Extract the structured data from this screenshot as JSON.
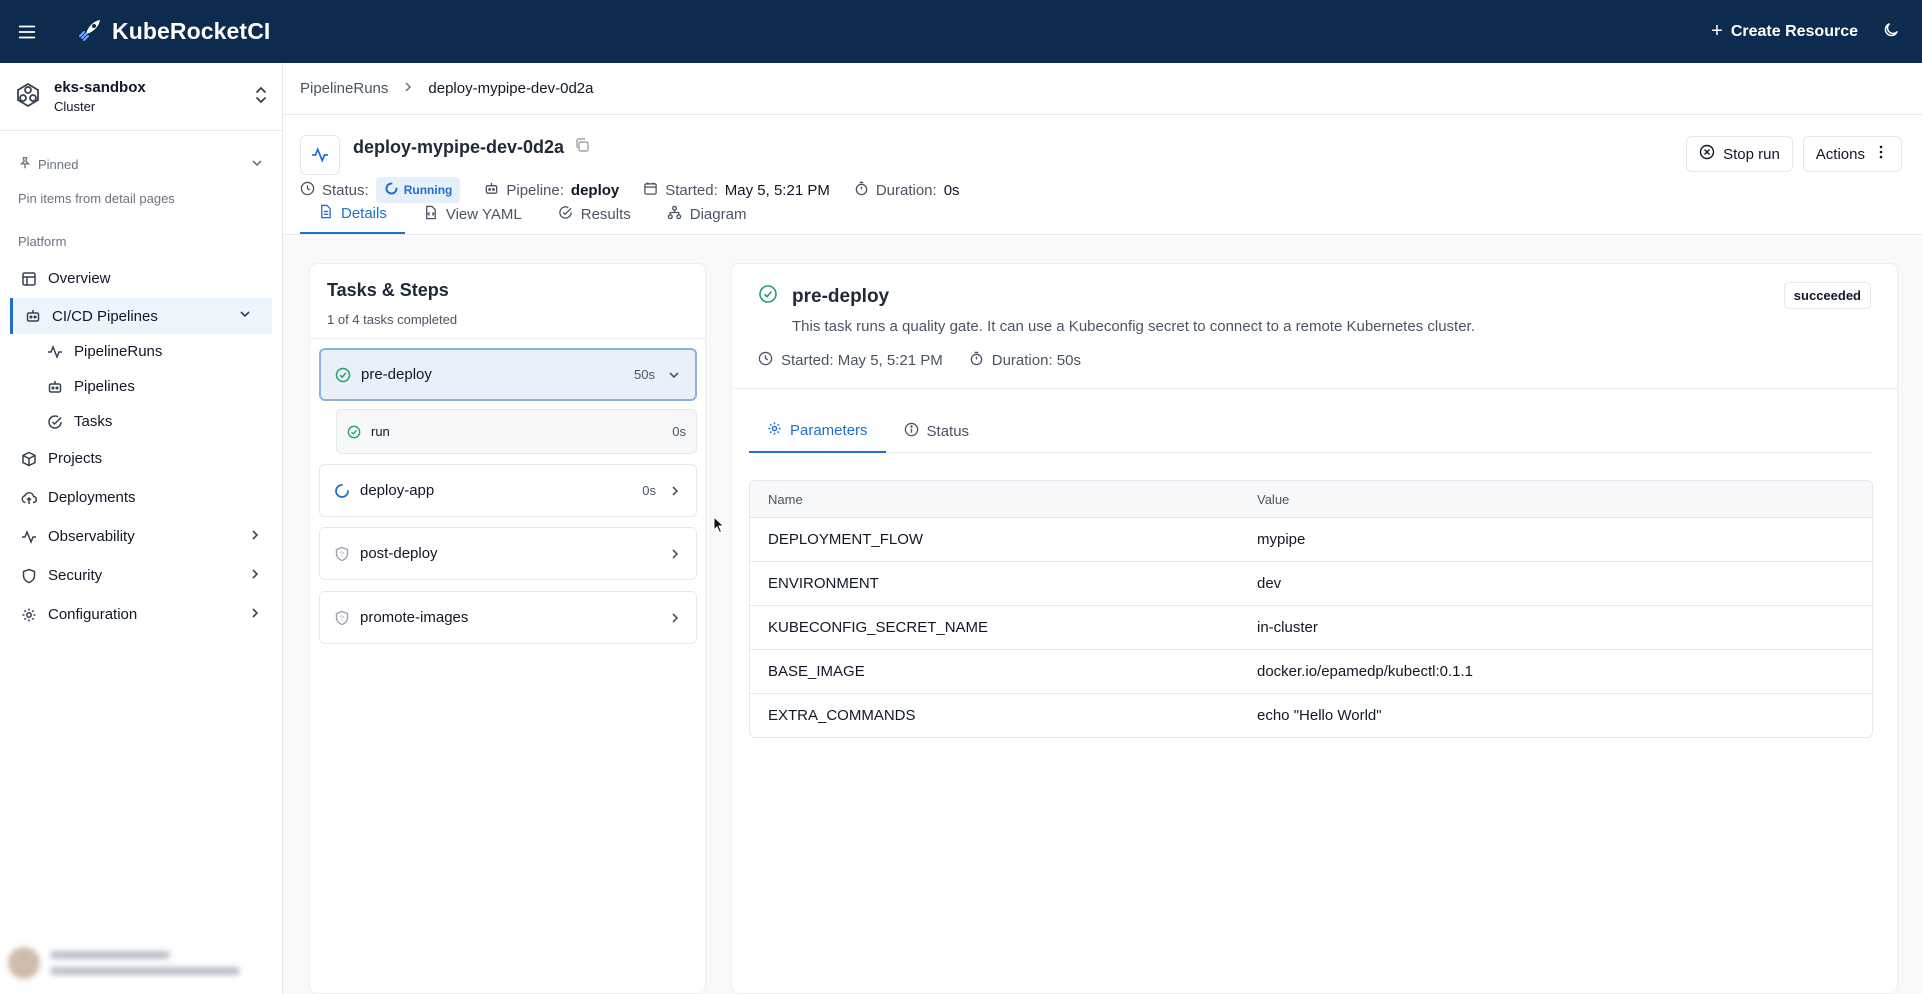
{
  "topbar": {
    "brand": "KubeRocketCI",
    "create_label": "Create Resource"
  },
  "sidebar": {
    "cluster": {
      "name": "eks-sandbox",
      "type": "Cluster"
    },
    "pinned_label": "Pinned",
    "pin_hint": "Pin items from detail pages",
    "section_label": "Platform",
    "items": [
      {
        "label": "Overview",
        "icon": "table-icon"
      },
      {
        "label": "CI/CD Pipelines",
        "icon": "bot-icon",
        "expanded": true
      },
      {
        "label": "PipelineRuns",
        "icon": "activity-icon"
      },
      {
        "label": "Pipelines",
        "icon": "bot-icon"
      },
      {
        "label": "Tasks",
        "icon": "check-circle-icon"
      },
      {
        "label": "Projects",
        "icon": "box-icon"
      },
      {
        "label": "Deployments",
        "icon": "cloud-upload-icon"
      },
      {
        "label": "Observability",
        "icon": "activity-icon"
      },
      {
        "label": "Security",
        "icon": "shield-icon"
      },
      {
        "label": "Configuration",
        "icon": "gear-icon"
      }
    ]
  },
  "breadcrumb": {
    "parent": "PipelineRuns",
    "current": "deploy-mypipe-dev-0d2a"
  },
  "header": {
    "title": "deploy-mypipe-dev-0d2a",
    "status_label": "Status:",
    "status_value": "Running",
    "pipeline_label": "Pipeline:",
    "pipeline_value": "deploy",
    "started_label": "Started:",
    "started_value": "May 5, 5:21 PM",
    "duration_label": "Duration:",
    "duration_value": "0s",
    "stop_label": "Stop run",
    "actions_label": "Actions",
    "tabs": [
      "Details",
      "View YAML",
      "Results",
      "Diagram"
    ]
  },
  "tasks": {
    "title": "Tasks & Steps",
    "subtitle": "1 of 4 tasks completed",
    "items": [
      {
        "name": "pre-deploy",
        "time": "50s",
        "status": "succeeded"
      },
      {
        "name": "deploy-app",
        "time": "0s",
        "status": "running"
      },
      {
        "name": "post-deploy",
        "time": "",
        "status": "pending"
      },
      {
        "name": "promote-images",
        "time": "",
        "status": "pending"
      }
    ],
    "step": {
      "name": "run",
      "time": "0s"
    }
  },
  "detail": {
    "title": "pre-deploy",
    "badge": "succeeded",
    "description": "This task runs a quality gate. It can use a Kubeconfig secret to connect to a remote Kubernetes cluster.",
    "started": "Started: May 5, 5:21 PM",
    "duration": "Duration: 50s",
    "tabs": [
      "Parameters",
      "Status"
    ],
    "table": {
      "columns": [
        "Name",
        "Value"
      ],
      "rows": [
        [
          "DEPLOYMENT_FLOW",
          "mypipe"
        ],
        [
          "ENVIRONMENT",
          "dev"
        ],
        [
          "KUBECONFIG_SECRET_NAME",
          "in-cluster"
        ],
        [
          "BASE_IMAGE",
          "docker.io/epamedp/kubectl:0.1.1"
        ],
        [
          "EXTRA_COMMANDS",
          "echo \"Hello World\""
        ]
      ]
    }
  },
  "colors": {
    "topbar": "#0d2a4f",
    "accent": "#1f6fd1",
    "success": "#22a06b"
  }
}
